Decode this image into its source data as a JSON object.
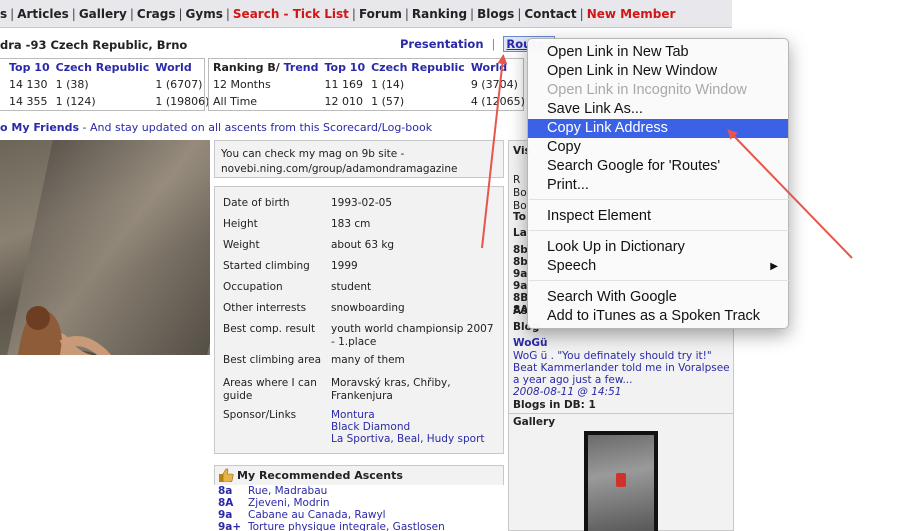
{
  "nav": {
    "items": [
      {
        "label": "s",
        "red": false
      },
      {
        "label": "Articles",
        "red": false
      },
      {
        "label": "Gallery",
        "red": false
      },
      {
        "label": "Crags",
        "red": false
      },
      {
        "label": "Gyms",
        "red": false
      },
      {
        "label": "Search - Tick List",
        "red": true
      },
      {
        "label": "Forum",
        "red": false
      },
      {
        "label": "Ranking",
        "red": false
      },
      {
        "label": "Blogs",
        "red": false
      },
      {
        "label": "Contact",
        "red": false
      },
      {
        "label": "New Member",
        "red": true
      }
    ],
    "separator": "|"
  },
  "header": {
    "climber": "dra -93 Czech Republic, Brno",
    "presentation": "Presentation",
    "routes": "Routes",
    "separator": "|"
  },
  "rank_left": {
    "headers": [
      "Top 10",
      "Czech Republic",
      "World"
    ],
    "rows": [
      [
        "14 130",
        "1 (38)",
        "1 (6707)"
      ],
      [
        "14 355",
        "1 (124)",
        "1 (19806)"
      ]
    ]
  },
  "rank_right": {
    "header_label": "Ranking B/",
    "header_trend": "Trend",
    "headers": [
      "Top 10",
      "Czech Republic",
      "World"
    ],
    "rows": [
      [
        "12 Months",
        "11 169",
        "1 (14)",
        "9 (3704)"
      ],
      [
        "All Time",
        "12 010",
        "1 (57)",
        "4 (12065)"
      ]
    ]
  },
  "friends": {
    "bold": "o My Friends",
    "rest": " - And stay updated on all ascents from this Scorecard/Log-book"
  },
  "mag": {
    "text": "You can check my mag on 9b site - novebi.ning.com/group/adamondramagazine"
  },
  "profile": [
    {
      "label": "Date of birth",
      "value": "1993-02-05"
    },
    {
      "label": "Height",
      "value": "183 cm"
    },
    {
      "label": "Weight",
      "value": "about 63 kg"
    },
    {
      "label": "Started climbing",
      "value": "1999"
    },
    {
      "label": "Occupation",
      "value": "student"
    },
    {
      "label": "Other interrests",
      "value": "snowboarding"
    },
    {
      "label": "Best comp. result",
      "value": "youth world championsip 2007 - 1.place"
    },
    {
      "label": "Best climbing area",
      "value": "many of them"
    },
    {
      "label": "Areas where I can guide",
      "value": "Moravský kras, Chřiby, Frankenjura"
    },
    {
      "label": "Sponsor/Links",
      "value": "Montura\nBlack Diamond\nLa Sportiva, Beal, Hudy sport"
    }
  ],
  "recommended": {
    "title": "My Recommended Ascents",
    "items": [
      {
        "grade": "8a",
        "name": "Rue, Madrabau"
      },
      {
        "grade": "8A",
        "name": "Zjeveni, Modrin"
      },
      {
        "grade": "9a",
        "name": "Cabane au Canada, Rawyl"
      },
      {
        "grade": "9a+",
        "name": "Torture physique integrale, Gastlosen"
      }
    ]
  },
  "sidebar": {
    "vis_label": "Vis",
    "rows_r": [
      "R",
      "Bo",
      "Bo"
    ],
    "to_label": "To",
    "la_label": "La",
    "grades": [
      "8b",
      "8b",
      "9a",
      "9a",
      "8B",
      "8A"
    ],
    "as_label": "As",
    "blog_label": "Blog",
    "blog_title": "WoGü",
    "blog_text": "WoG ü . \"You definately should try it!\" Beat Kammerlander told me in Voralpsee a year ago just a few...",
    "blog_date": "2008-08-11 @ 14:51",
    "blogs_in_db": "Blogs in DB: 1",
    "gallery_label": "Gallery"
  },
  "context_menu": {
    "items": [
      {
        "label": "Open Link in New Tab",
        "disabled": false,
        "active": false
      },
      {
        "label": "Open Link in New Window",
        "disabled": false,
        "active": false
      },
      {
        "label": "Open Link in Incognito Window",
        "disabled": true,
        "active": false
      },
      {
        "label": "Save Link As...",
        "disabled": false,
        "active": false
      },
      {
        "label": "Copy Link Address",
        "disabled": false,
        "active": true
      },
      {
        "label": "Copy",
        "disabled": false,
        "active": false
      },
      {
        "label": "Search Google for 'Routes'",
        "disabled": false,
        "active": false
      },
      {
        "label": "Print...",
        "disabled": false,
        "active": false
      },
      {
        "label": "Inspect Element",
        "disabled": false,
        "active": false
      },
      {
        "label": "Look Up in Dictionary",
        "disabled": false,
        "active": false
      },
      {
        "label": "Speech",
        "disabled": false,
        "active": false,
        "submenu": true
      },
      {
        "label": "Search With Google",
        "disabled": false,
        "active": false
      },
      {
        "label": "Add to iTunes as a Spoken Track",
        "disabled": false,
        "active": false
      }
    ]
  },
  "colors": {
    "link_blue": "#2a2aa8",
    "nav_red": "#d21616",
    "menu_highlight": "#3b62e6",
    "arrow_red": "#e8554a"
  }
}
